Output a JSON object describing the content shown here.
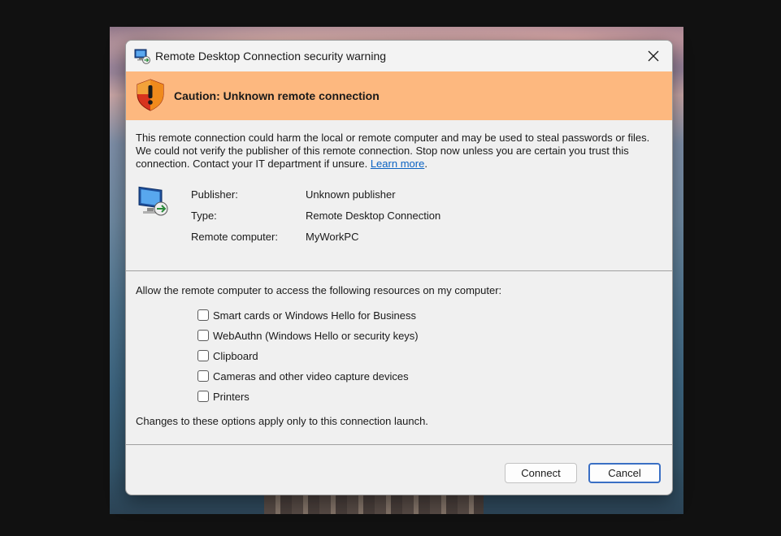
{
  "window": {
    "title": "Remote Desktop Connection security warning",
    "title_icon": "remote-desktop-icon",
    "close_icon": "close-icon"
  },
  "banner": {
    "text": "Caution: Unknown remote connection",
    "icon": "shield-warning-icon",
    "color": "#fdb87f"
  },
  "warning": {
    "text": "This remote connection could harm the local or remote computer and may be used to steal passwords or files. We could not verify the publisher of this remote connection. Stop now unless you are certain you trust this connection. Contact your IT department if unsure.",
    "link": "Learn more",
    "period": "."
  },
  "info": {
    "icon": "remote-computer-icon",
    "rows": [
      {
        "label": "Publisher:",
        "value": "Unknown publisher"
      },
      {
        "label": "Type:",
        "value": "Remote Desktop Connection"
      },
      {
        "label": "Remote computer:",
        "value": "MyWorkPC"
      }
    ]
  },
  "resources": {
    "title": "Allow the remote computer to access the following resources on my computer:",
    "items": [
      {
        "label": "Smart cards or Windows Hello for Business",
        "checked": false
      },
      {
        "label": "WebAuthn (Windows Hello or security keys)",
        "checked": false
      },
      {
        "label": "Clipboard",
        "checked": false
      },
      {
        "label": "Cameras and other video capture devices",
        "checked": false
      },
      {
        "label": "Printers",
        "checked": false
      }
    ],
    "note": "Changes to these options apply only to this connection launch."
  },
  "buttons": {
    "connect": "Connect",
    "cancel": "Cancel",
    "focus_color": "#3a6fc4"
  }
}
